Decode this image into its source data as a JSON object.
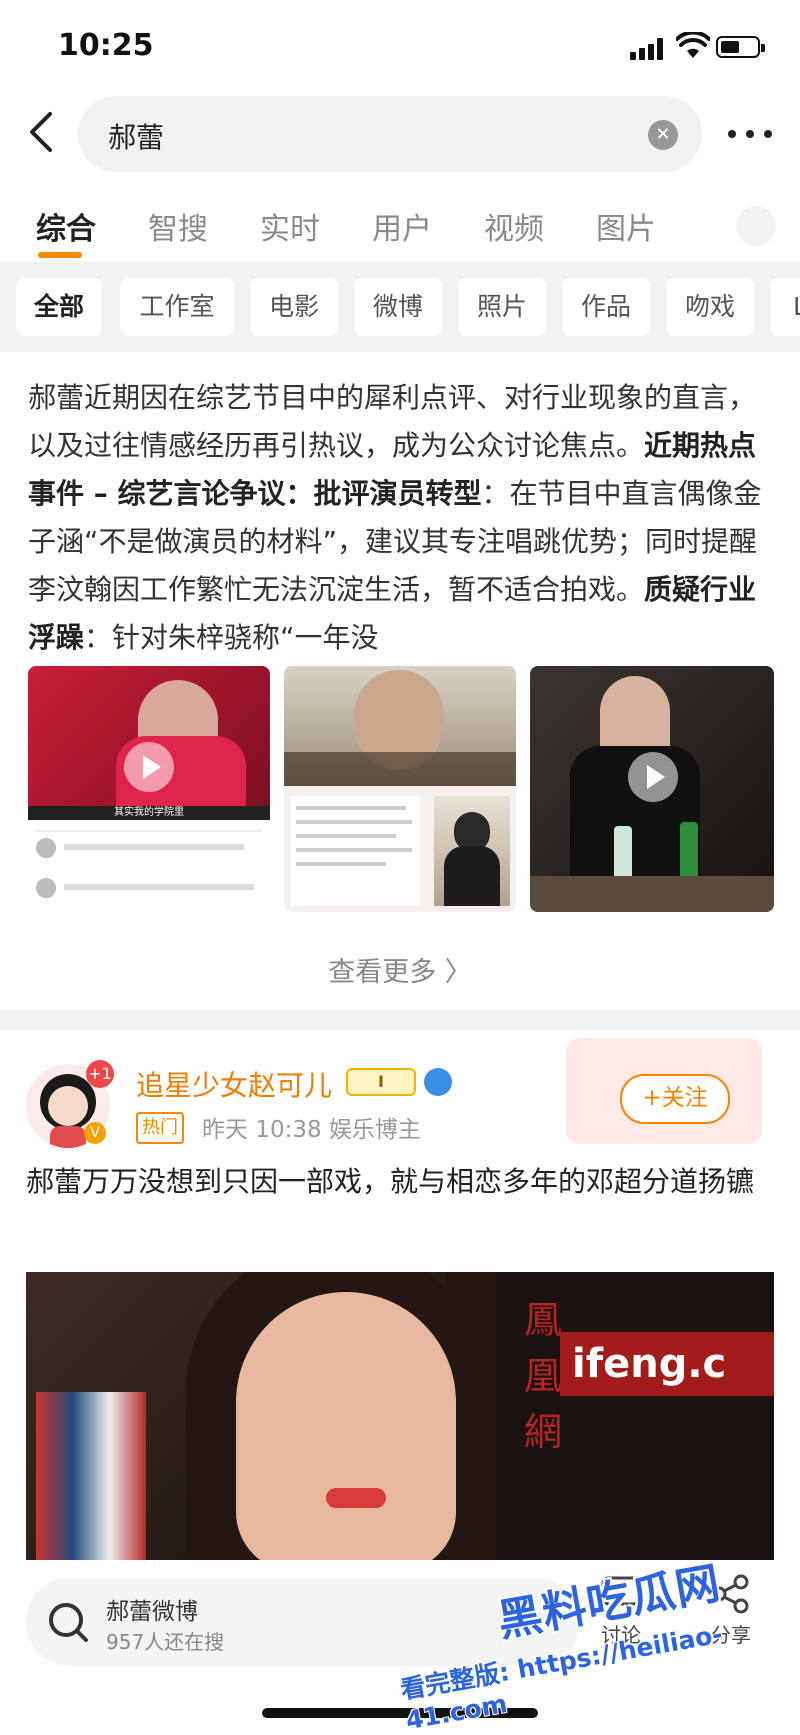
{
  "status_bar": {
    "time": "10:25"
  },
  "search": {
    "query": "郝蕾"
  },
  "tabs": [
    {
      "label": "综合",
      "active": true
    },
    {
      "label": "智搜"
    },
    {
      "label": "实时"
    },
    {
      "label": "用户"
    },
    {
      "label": "视频"
    },
    {
      "label": "图片"
    }
  ],
  "filters": [
    "全部",
    "工作室",
    "电影",
    "微博",
    "照片",
    "作品",
    "吻戏",
    "L"
  ],
  "summary": {
    "line1": "郝蕾近期因在综艺节目中的犀利点评、对行业现象的直言，以及过往情感经历再引热议，成为公众讨论焦点。",
    "bold1": "近期热点事件 – 综艺言论争议：批评演员转型",
    "text2": "：在节目中直言偶像金子涵“不是做演员的材料”，建议其专注唱跳优势；同时提醒李汶翰因工作繁忙无法沉淀生活，暂不适合拍戏。",
    "bold2": "质疑行业浮躁",
    "text3": "：针对朱梓骁称“一年没"
  },
  "thumbs": {
    "t1_caption": "其实我的学院里"
  },
  "see_more": "查看更多 〉",
  "post": {
    "username": "追星少女赵可儿",
    "notif_count": "+1",
    "vip_level": "I",
    "hot_tag": "热门",
    "meta": "昨天 10:38  娱乐博主",
    "follow": "+关注",
    "text": "郝蕾万万没想到只因一部戏，就与相恋多年的邓超分道扬镳",
    "image_sign_text": "ifeng.c",
    "image_sign_chars": [
      "鳳",
      "凰",
      "網"
    ]
  },
  "bottom": {
    "search_title": "郝蕾微博",
    "search_sub": "957人还在搜",
    "action_comment": "讨论",
    "action_share": "分享"
  },
  "watermark": {
    "line1": "黑料吃瓜网",
    "line2": "看完整版: https://heiliao-41.com"
  },
  "colors": {
    "accent": "#ff8200",
    "brand_orange": "#f07d00",
    "watermark_blue": "#2b63e0"
  }
}
